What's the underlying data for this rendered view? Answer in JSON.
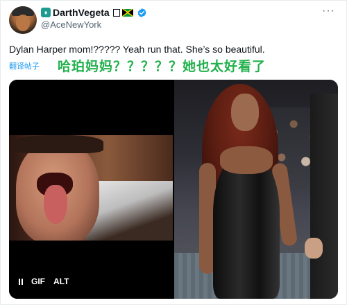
{
  "user": {
    "display_name": "DarthVegeta",
    "unknown_glyph": "",
    "handle": "@AceNewYork",
    "avatar_icon": "avatar-photo-icon",
    "app_icon": "app-badge-icon",
    "flag_icon": "jamaica-flag-icon",
    "verified_icon": "verified-badge-icon",
    "verified_color": "#1d9bf0"
  },
  "header": {
    "more_label": "···"
  },
  "tweet": {
    "text": "Dylan Harper mom!????? Yeah run that. She’s so beautiful.",
    "translate_link": "翻译帖子",
    "translation": "哈珀妈妈？？？？？她也太好看了",
    "translation_color": "#22b14c"
  },
  "media": {
    "gif_controls": {
      "pause_icon": "pause-icon",
      "gif_label": "GIF",
      "alt_label": "ALT"
    }
  }
}
